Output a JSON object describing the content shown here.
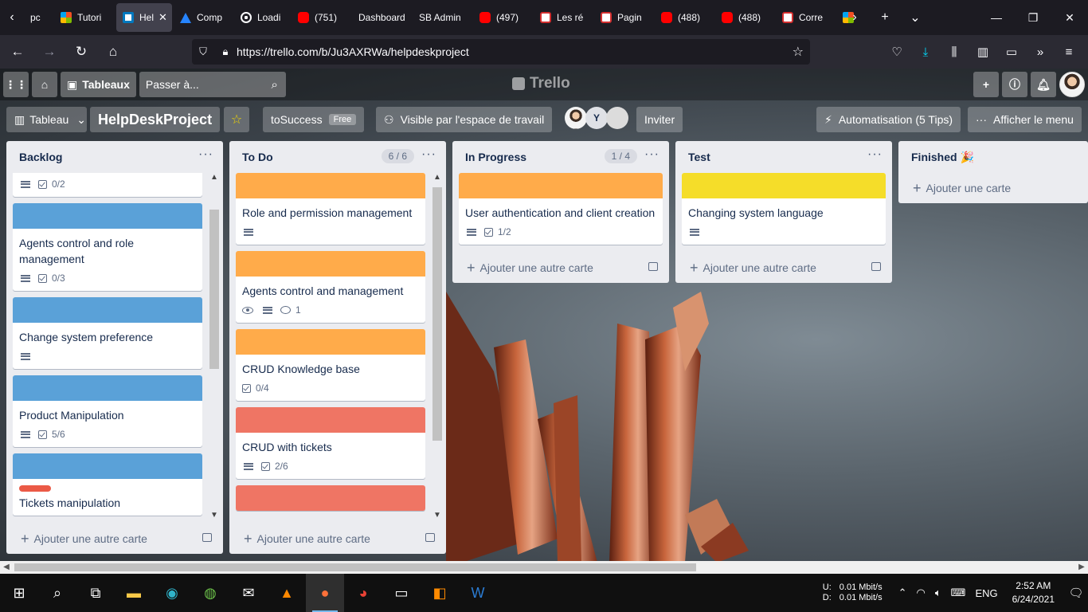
{
  "browser": {
    "tabs": [
      {
        "label": "pc",
        "favicon": "partial"
      },
      {
        "label": "Tutori",
        "favicon": "ms"
      },
      {
        "label": "Hel",
        "favicon": "trello",
        "active": true
      },
      {
        "label": "Comp",
        "favicon": "atl"
      },
      {
        "label": "Loadi",
        "favicon": "loading"
      },
      {
        "label": "(751) ",
        "favicon": "yt"
      },
      {
        "label": "Dashboard",
        "favicon": "none"
      },
      {
        "label": "SB Admin",
        "favicon": "none"
      },
      {
        "label": "(497) ",
        "favicon": "yt"
      },
      {
        "label": "Les ré",
        "favicon": "les"
      },
      {
        "label": "Pagin",
        "favicon": "les"
      },
      {
        "label": "(488) ",
        "favicon": "yt"
      },
      {
        "label": "(488) ",
        "favicon": "yt"
      },
      {
        "label": "Corre",
        "favicon": "les"
      },
      {
        "label": "",
        "favicon": "ms"
      }
    ],
    "url": "https://trello.com/b/Ju3AXRWa/helpdeskproject"
  },
  "trello": {
    "boards_label": "Tableaux",
    "search_placeholder": "Passer à...",
    "logo_text": "Trello"
  },
  "board": {
    "view_label": "Tableau",
    "title": "HelpDeskProject",
    "workspace": "toSuccess",
    "plan_badge": "Free",
    "visibility": "Visible par l'espace de travail",
    "member_initial": "Y",
    "invite": "Inviter",
    "automation": "Automatisation (5 Tips)",
    "menu": "Afficher le menu"
  },
  "lists": [
    {
      "title": "Backlog",
      "count": "",
      "add_label": "Ajouter une autre carte",
      "cards": [
        {
          "cover": "",
          "title": "",
          "desc": true,
          "checklist": "0/2",
          "partial_top": true
        },
        {
          "cover": "#5aa1d8",
          "title": "Agents control and role management",
          "desc": true,
          "checklist": "0/3"
        },
        {
          "cover": "#5aa1d8",
          "title": "Change system preference",
          "desc": true,
          "checklist": ""
        },
        {
          "cover": "#5aa1d8",
          "title": "Product Manipulation",
          "desc": true,
          "checklist": "5/6"
        },
        {
          "cover": "#5aa1d8",
          "title": "Tickets manipulation",
          "label": "#eb5a46",
          "desc": false,
          "checklist": ""
        }
      ]
    },
    {
      "title": "To Do",
      "count": "6 / 6",
      "add_label": "Ajouter une autre carte",
      "cards": [
        {
          "cover": "#ffab4a",
          "title": "Role and permission management",
          "desc": true,
          "checklist": ""
        },
        {
          "cover": "#ffab4a",
          "title": "Agents control and management",
          "watch": true,
          "desc": true,
          "comments": "1"
        },
        {
          "cover": "#ffab4a",
          "title": "CRUD Knowledge base",
          "desc": false,
          "checklist": "0/4"
        },
        {
          "cover": "#ef7564",
          "title": "CRUD with tickets",
          "desc": true,
          "checklist": "2/6"
        },
        {
          "cover": "#ef7564",
          "title": "",
          "desc": false,
          "checklist": ""
        }
      ]
    },
    {
      "title": "In Progress",
      "count": "1 / 4",
      "add_label": "Ajouter une autre carte",
      "cards": [
        {
          "cover": "#ffab4a",
          "title": "User authentication and client creation",
          "desc": true,
          "checklist": "1/2"
        }
      ]
    },
    {
      "title": "Test",
      "count": "",
      "add_label": "Ajouter une autre carte",
      "cards": [
        {
          "cover": "#f5dd29",
          "title": "Changing system language",
          "desc": true,
          "checklist": ""
        }
      ]
    },
    {
      "title": "Finished 🎉",
      "count": "",
      "add_label": "Ajouter une carte",
      "cards": []
    }
  ],
  "taskbar": {
    "net_u_label": "U:",
    "net_d_label": "D:",
    "net_u": "0.01 Mbit/s",
    "net_d": "0.01 Mbit/s",
    "lang": "ENG",
    "time": "2:52 AM",
    "date": "6/24/2021",
    "notif_count": "1"
  }
}
